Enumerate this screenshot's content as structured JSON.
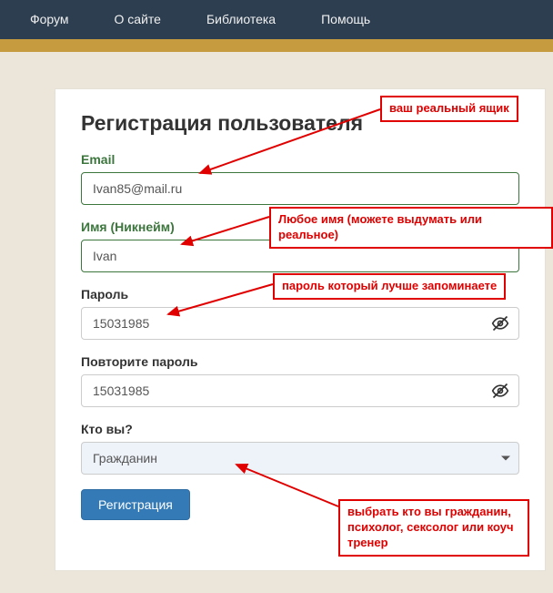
{
  "nav": {
    "forum": "Форум",
    "about": "О сайте",
    "library": "Библиотека",
    "help": "Помощь"
  },
  "form": {
    "title": "Регистрация пользователя",
    "email_label": "Email",
    "email_value": "Ivan85@mail.ru",
    "name_label": "Имя (Никнейм)",
    "name_value": "Ivan",
    "password_label": "Пароль",
    "password_value": "15031985",
    "password2_label": "Повторите пароль",
    "password2_value": "15031985",
    "role_label": "Кто вы?",
    "role_value": "Гражданин",
    "submit": "Регистрация"
  },
  "annot": {
    "email": "ваш реальный ящик",
    "name": "Любое имя (можете выдумать или реальное)",
    "password": "пароль который лучше запоминаете",
    "role": "выбрать кто вы гражданин, психолог, сексолог или коуч тренер"
  }
}
